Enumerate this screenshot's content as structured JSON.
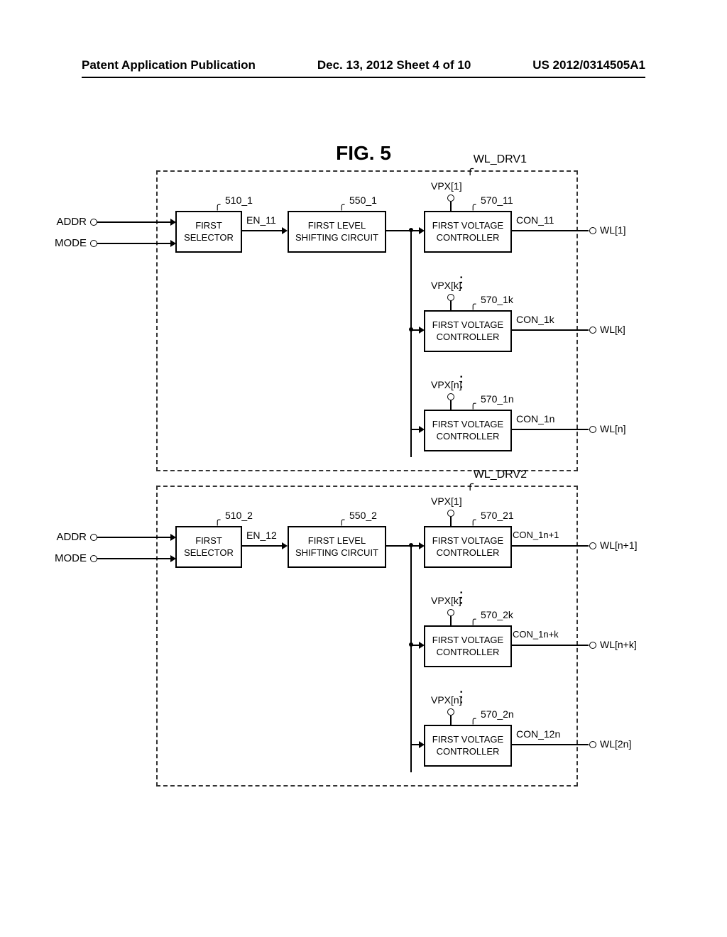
{
  "header": {
    "left": "Patent Application Publication",
    "center": "Dec. 13, 2012  Sheet 4 of 10",
    "right": "US 2012/0314505A1"
  },
  "figure_title": "FIG.  5",
  "inputs": {
    "addr": "ADDR",
    "mode": "MODE"
  },
  "drv1": {
    "label": "WL_DRV1",
    "selector_ref": "510_1",
    "selector": "FIRST\nSELECTOR",
    "en": "EN_11",
    "level_ref": "550_1",
    "level": "FIRST LEVEL\nSHIFTING CIRCUIT",
    "vc1": {
      "vpx": "VPX[1]",
      "ref": "570_11",
      "label": "FIRST VOLTAGE\nCONTROLLER",
      "con": "CON_11",
      "wl": "WL[1]"
    },
    "vc2": {
      "vpx": "VPX[k]",
      "ref": "570_1k",
      "label": "FIRST VOLTAGE\nCONTROLLER",
      "con": "CON_1k",
      "wl": "WL[k]"
    },
    "vc3": {
      "vpx": "VPX[n]",
      "ref": "570_1n",
      "label": "FIRST VOLTAGE\nCONTROLLER",
      "con": "CON_1n",
      "wl": "WL[n]"
    }
  },
  "drv2": {
    "label": "WL_DRV2",
    "selector_ref": "510_2",
    "selector": "FIRST\nSELECTOR",
    "en": "EN_12",
    "level_ref": "550_2",
    "level": "FIRST LEVEL\nSHIFTING CIRCUIT",
    "vc1": {
      "vpx": "VPX[1]",
      "ref": "570_21",
      "label": "FIRST VOLTAGE\nCONTROLLER",
      "con": "CON_1n+1",
      "wl": "WL[n+1]"
    },
    "vc2": {
      "vpx": "VPX[k]",
      "ref": "570_2k",
      "label": "FIRST VOLTAGE\nCONTROLLER",
      "con": "CON_1n+k",
      "wl": "WL[n+k]"
    },
    "vc3": {
      "vpx": "VPX[n]",
      "ref": "570_2n",
      "label": "FIRST VOLTAGE\nCONTROLLER",
      "con": "CON_12n",
      "wl": "WL[2n]"
    }
  }
}
